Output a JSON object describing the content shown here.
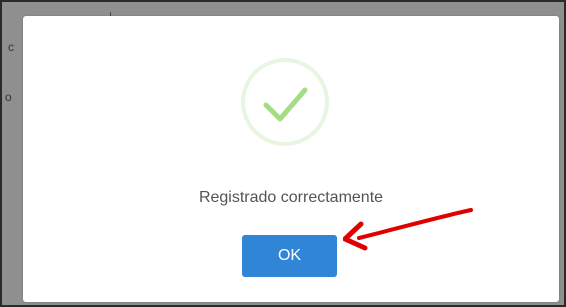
{
  "background": {
    "fragment_1": "c",
    "fragment_2": "o"
  },
  "dialog": {
    "icon": "checkmark-icon",
    "message": "Registrado correctamente",
    "ok_label": "OK"
  },
  "annotation": {
    "icon": "red-arrow-icon"
  },
  "colors": {
    "button": "#3085d6",
    "check": "#a5dc86",
    "arrow": "#e00000",
    "message": "#545454"
  }
}
